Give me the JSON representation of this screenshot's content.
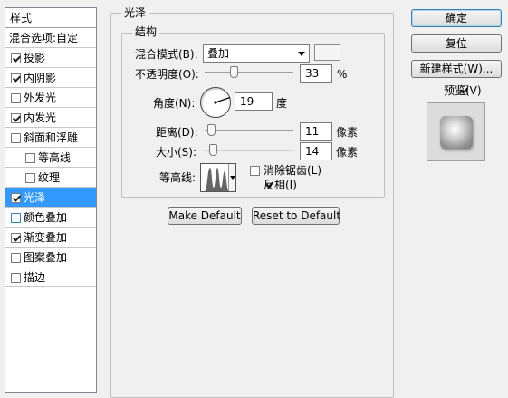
{
  "style_list": {
    "header": "样式",
    "blend_options": "混合选项:自定",
    "items": [
      {
        "label": "投影",
        "checked": true,
        "sub": false,
        "selected": false
      },
      {
        "label": "内阴影",
        "checked": true,
        "sub": false,
        "selected": false
      },
      {
        "label": "外发光",
        "checked": false,
        "sub": false,
        "selected": false
      },
      {
        "label": "内发光",
        "checked": true,
        "sub": false,
        "selected": false
      },
      {
        "label": "斜面和浮雕",
        "checked": false,
        "sub": false,
        "selected": false
      },
      {
        "label": "等高线",
        "checked": false,
        "sub": true,
        "selected": false
      },
      {
        "label": "纹理",
        "checked": false,
        "sub": true,
        "selected": false
      },
      {
        "label": "光泽",
        "checked": true,
        "sub": false,
        "selected": true
      },
      {
        "label": "颜色叠加",
        "checked": false,
        "sub": false,
        "selected": false
      },
      {
        "label": "渐变叠加",
        "checked": true,
        "sub": false,
        "selected": false
      },
      {
        "label": "图案叠加",
        "checked": false,
        "sub": false,
        "selected": false
      },
      {
        "label": "描边",
        "checked": false,
        "sub": false,
        "selected": false
      }
    ]
  },
  "satin": {
    "group_title": "光泽",
    "structure_title": "结构",
    "blend_mode_label": "混合模式(B):",
    "blend_mode_value": "叠加",
    "opacity_label": "不透明度(O):",
    "opacity_value": "33",
    "opacity_unit": "%",
    "angle_label": "角度(N):",
    "angle_value": "19",
    "angle_unit": "度",
    "distance_label": "距离(D):",
    "distance_value": "11",
    "distance_unit": "像素",
    "size_label": "大小(S):",
    "size_value": "14",
    "size_unit": "像素",
    "contour_label": "等高线:",
    "antialias_label": "消除锯齿(L)",
    "antialias_checked": false,
    "invert_label": "反相(I)",
    "invert_checked": true,
    "make_default": "Make Default",
    "reset_default": "Reset to Default"
  },
  "buttons": {
    "ok": "确定",
    "reset": "复位",
    "new_style": "新建样式(W)...",
    "preview_label": "预览(V)",
    "preview_checked": true
  },
  "colors": {
    "selection": "#3399ff",
    "default_border": "#3c7fb1"
  }
}
